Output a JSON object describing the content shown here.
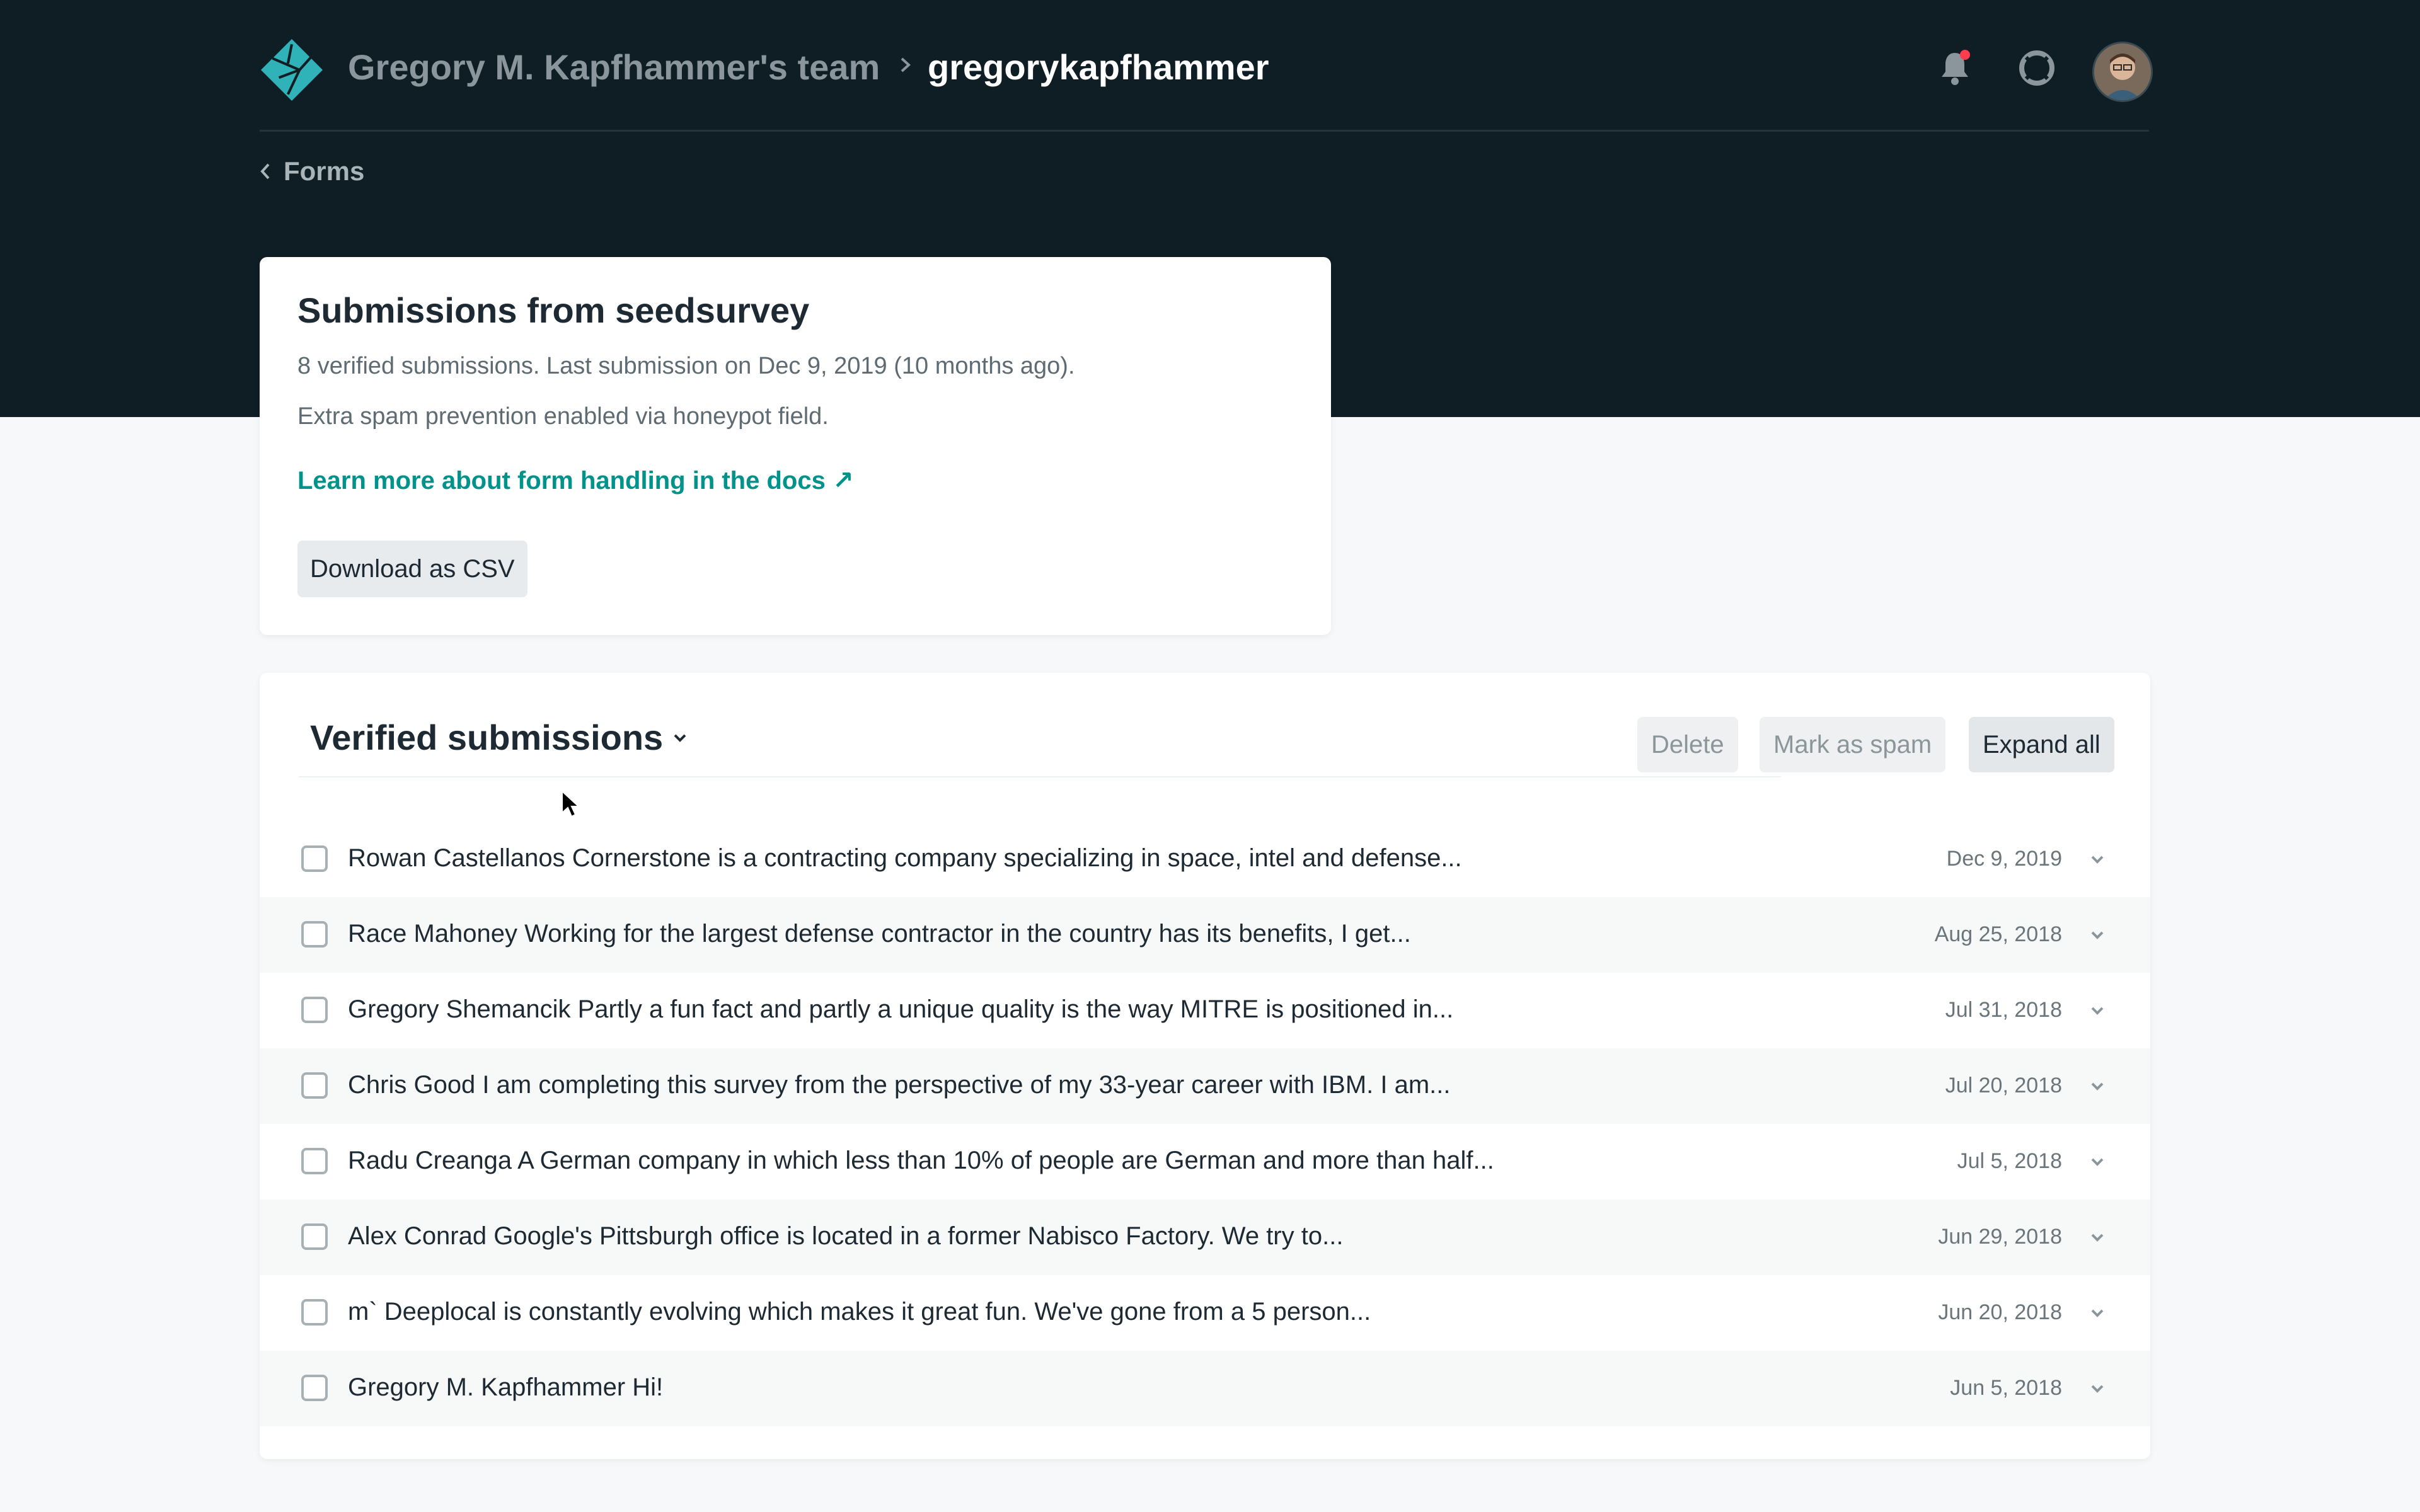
{
  "topbar": {
    "team_name": "Gregory M. Kapfhammer's team",
    "site_name": "gregorykapfhammer",
    "icons": [
      "netlify-logo-icon",
      "chevron-right-icon",
      "bell-icon",
      "help-lifebuoy-icon",
      "avatar"
    ],
    "notification_dot_color": "#ff3b4e"
  },
  "back": {
    "label": "Forms"
  },
  "form_card": {
    "title": "Submissions from seedsurvey",
    "summary": "8 verified submissions. Last submission on Dec 9, 2019 (10 months ago).",
    "spam_note": "Extra spam prevention enabled via honeypot field.",
    "docs_link": "Learn more about form handling in the docs ↗",
    "csv_button": "Download as CSV",
    "link_color": "#00938b"
  },
  "submissions": {
    "heading": "Verified submissions",
    "actions": {
      "delete": "Delete",
      "spam": "Mark as spam",
      "expand": "Expand all"
    },
    "rows": [
      {
        "text": "Rowan Castellanos Cornerstone is a contracting company specializing in space, intel and defense...",
        "date": "Dec 9, 2019"
      },
      {
        "text": "Race Mahoney Working for the largest defense contractor in the country has its benefits, I get...",
        "date": "Aug 25, 2018"
      },
      {
        "text": "Gregory Shemancik Partly a fun fact and partly a unique quality is the way MITRE is positioned in...",
        "date": "Jul 31, 2018"
      },
      {
        "text": "Chris Good I am completing this survey from the perspective of my 33-year career with IBM. I am...",
        "date": "Jul 20, 2018"
      },
      {
        "text": "Radu Creanga A German company in which less than 10% of people are German and more than half...",
        "date": "Jul 5, 2018"
      },
      {
        "text": "Alex Conrad Google's Pittsburgh office is located in a former Nabisco Factory. We try to...",
        "date": "Jun 29, 2018"
      },
      {
        "text": "m` Deeplocal is constantly evolving which makes it great fun. We've gone from a 5 person...",
        "date": "Jun 20, 2018"
      },
      {
        "text": "Gregory M. Kapfhammer Hi!",
        "date": "Jun 5, 2018"
      }
    ]
  }
}
